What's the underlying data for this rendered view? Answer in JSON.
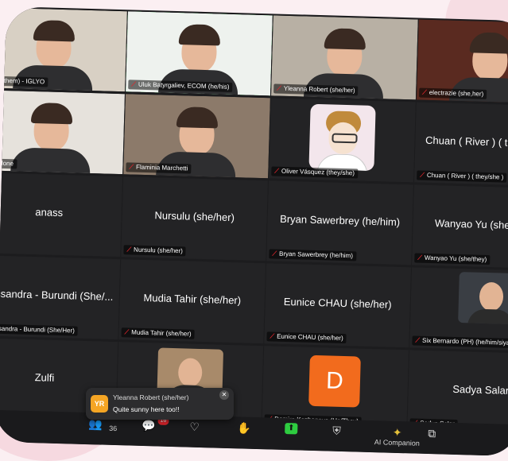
{
  "participants": [
    {
      "label": "(he/them) - IGLYO",
      "center": "",
      "type": "video",
      "bg": "#d8d0c4"
    },
    {
      "label": "Uluk Batyrgaliev, ECOM (he/his)",
      "center": "",
      "type": "video",
      "bg": "#eef2ee",
      "speaking": true
    },
    {
      "label": "Yleanna Robert (she/her)",
      "center": "",
      "type": "video",
      "bg": "#b8b0a4"
    },
    {
      "label": "electrazie (she,her)",
      "center": "",
      "type": "video",
      "bg": "#5a2a20"
    },
    {
      "label": "Madone",
      "center": "",
      "type": "video",
      "bg": "#e6e2dc"
    },
    {
      "label": "Flaminia Marchetti",
      "center": "",
      "type": "video",
      "bg": "#8c7a6a"
    },
    {
      "label": "Oliver Vásquez (they/she)",
      "center": "",
      "type": "avatar",
      "bg": "#232325"
    },
    {
      "label": "Chuan ( River ) ( they/she )",
      "center": "Chuan ( River ) ( they/she )",
      "type": "name"
    },
    {
      "label": "",
      "center": "anass",
      "type": "name"
    },
    {
      "label": "Nursulu (she/her)",
      "center": "Nursulu (she/her)",
      "type": "name"
    },
    {
      "label": "Bryan Sawerbrey (he/him)",
      "center": "Bryan Sawerbrey (he/him)",
      "type": "name"
    },
    {
      "label": "Wanyao Yu (she/they)",
      "center": "Wanyao Yu (she/they)",
      "type": "name"
    },
    {
      "label": "Alessandra - Burundi (She/Her)",
      "center": "Alessandra - Burundi (She/...",
      "type": "name"
    },
    {
      "label": "Mudia Tahir (she/her)",
      "center": "Mudia Tahir (she/her)",
      "type": "name"
    },
    {
      "label": "Eunice CHAU (she/her)",
      "center": "Eunice CHAU (she/her)",
      "type": "name"
    },
    {
      "label": "Six Bernardo (PH) (he/him/siya)",
      "center": "",
      "type": "smallvideo",
      "bg": "#3a3e44"
    },
    {
      "label": "",
      "center": "Zulfi",
      "type": "name"
    },
    {
      "label": "(they/she)",
      "center": "",
      "type": "smallvideo",
      "bg": "#a88a6a"
    },
    {
      "label": "Damira Kazhenova (He/They)",
      "center": "",
      "type": "initial",
      "initial": "D"
    },
    {
      "label": "Sadya Salar",
      "center": "Sadya Salar",
      "type": "name"
    }
  ],
  "chat": {
    "sender": "Yleanna Robert (she/her)",
    "message": "Quite sunny here too!!",
    "initials": "YR"
  },
  "toolbar": {
    "participants_count": "36",
    "chat_badge": "16",
    "items": [
      {
        "icon": "participants-icon",
        "glyph": "👥",
        "label": ""
      },
      {
        "icon": "chat-icon",
        "glyph": "💬",
        "label": ""
      },
      {
        "icon": "react-icon",
        "glyph": "♡",
        "label": ""
      },
      {
        "icon": "raise-hand-icon",
        "glyph": "✋",
        "label": ""
      },
      {
        "icon": "share-icon",
        "glyph": "⬆",
        "label": ""
      },
      {
        "icon": "security-icon",
        "glyph": "⛨",
        "label": ""
      },
      {
        "icon": "ai-companion-icon",
        "glyph": "✦",
        "label": "AI Companion"
      },
      {
        "icon": "apps-icon",
        "glyph": "⧉",
        "label": ""
      }
    ]
  },
  "colors": {
    "accent": "#38b34a",
    "mic_off": "#e0252b",
    "initial_tile": "#f26b1d"
  }
}
